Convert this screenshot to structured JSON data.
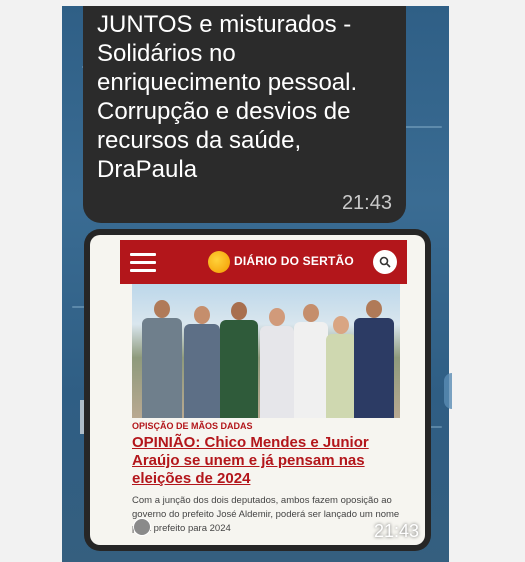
{
  "messages": {
    "text_message": {
      "text": "JUNTOS e misturados -\nSolidários no\nenriquecimento pessoal.\nCorrupção e desvios de\nrecursos da saúde,\nDraPaula",
      "time": "21:43"
    },
    "image_message": {
      "time": "21:43",
      "screenshot": {
        "site_name": "DIÁRIO DO SERTÃO",
        "brand_color": "#b3161b",
        "category": "OPISÇÃO DE MÃOS DADAS",
        "headline": "OPINIÃO: Chico Mendes e Junior Araújo se unem e já pensam nas eleições de 2024",
        "summary": "Com a junção dos dois deputados, ambos fazem oposição ao governo do prefeito José Aldemir, poderá ser lançado um nome para prefeito para 2024"
      }
    }
  },
  "icons": [
    "hamburger-menu-icon",
    "diario-logo-icon",
    "search-icon",
    "avatar-icon"
  ]
}
